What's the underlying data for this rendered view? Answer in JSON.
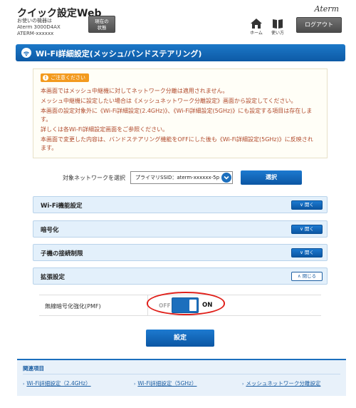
{
  "header": {
    "app_title": "クイック設定Web",
    "device_lines": [
      "お使いの機器は",
      "Aterm 3000D4AX",
      "ATERM-xxxxxx"
    ],
    "status_button": [
      "現在の",
      "状態"
    ],
    "brand": "Aterm",
    "home_label": "ホーム",
    "help_label": "使い方",
    "logout_label": "ログアウト"
  },
  "page": {
    "title": "Wi-Fi詳細設定(メッシュ/バンドステアリング)"
  },
  "notice": {
    "badge": "ご注意ください",
    "lines": [
      "本画面ではメッシュ中継機に対してネットワーク分離は適用されません。",
      "メッシュ中継機に設定したい場合は《メッシュネットワーク分離設定》画面から設定してください。",
      "本画面の設定対象外に《Wi-Fi詳細設定(2.4GHz)》、《Wi-Fi詳細設定(5GHz)》にも設定する項目は存在しま",
      "す。",
      "詳しくは各Wi-Fi詳細設定画面をご参照ください。",
      "本画面で変更した内容は、バンドステアリング機能をOFFにした後も《Wi-Fi詳細設定(5GHz)》に反映され",
      "ます。"
    ]
  },
  "network": {
    "label": "対象ネットワークを選択",
    "selected": "プライマリSSID：aterm-xxxxxx-5p",
    "select_button": "選択"
  },
  "sections": [
    {
      "label": "Wi-Fi機能設定",
      "button": "開く",
      "state": "collapsed"
    },
    {
      "label": "暗号化",
      "button": "開く",
      "state": "collapsed"
    },
    {
      "label": "子機の接続制限",
      "button": "開く",
      "state": "collapsed"
    },
    {
      "label": "拡張設定",
      "button": "閉じる",
      "state": "expanded"
    }
  ],
  "pmf": {
    "label": "無線暗号化強化(PMF)",
    "off_label": "OFF",
    "on_label": "ON",
    "value": "ON"
  },
  "submit_label": "設定",
  "related": {
    "title": "関連項目",
    "links": [
      "Wi-Fi詳細設定（2.4GHz）",
      "Wi-Fi詳細設定（5GHz）",
      "メッシュネットワーク分離設定"
    ]
  },
  "colors": {
    "primary_blue": "#1c6fbd",
    "notice_text": "#b04a2c",
    "notice_badge": "#f39a1e",
    "highlight_ring": "#e0201a"
  },
  "icons": {
    "home": "home-icon",
    "help": "book-icon",
    "wifi": "wifi-icon"
  }
}
